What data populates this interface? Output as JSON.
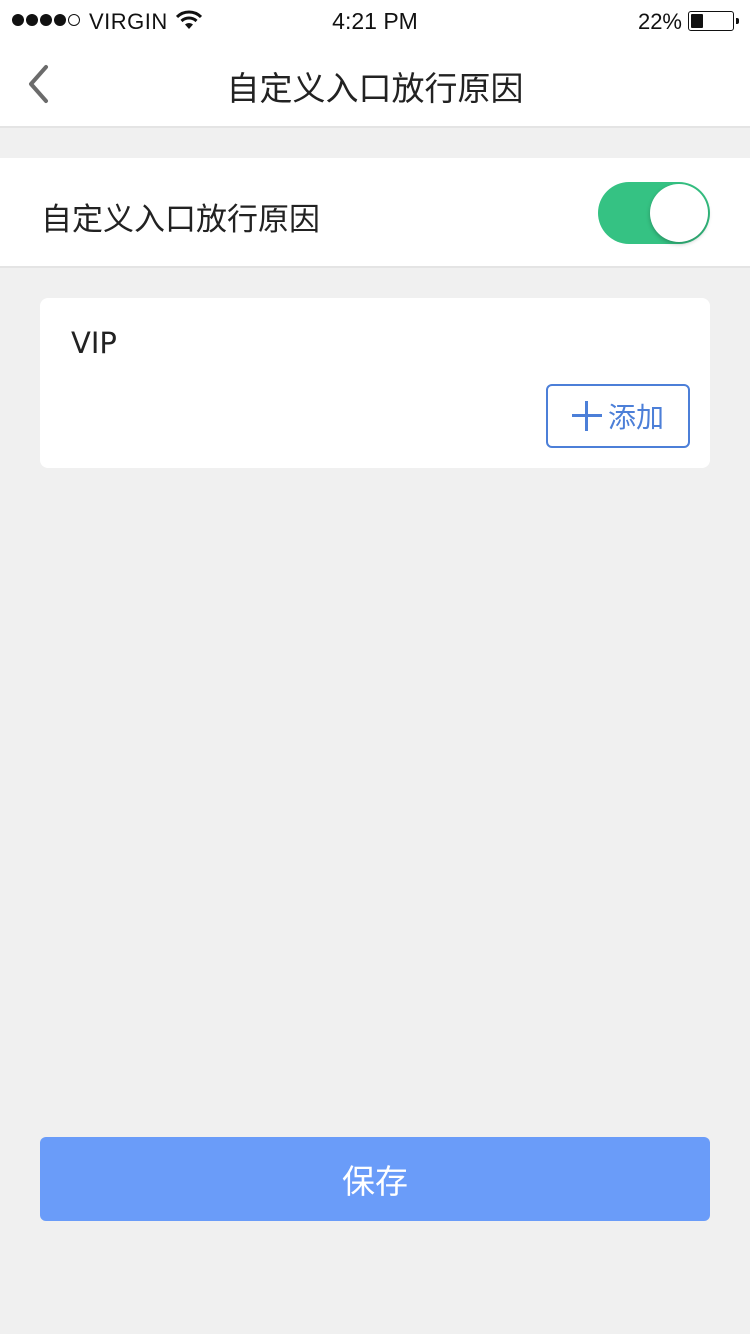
{
  "status_bar": {
    "carrier": "VIRGIN",
    "time": "4:21 PM",
    "battery_percent": "22%",
    "battery_level": 0.22,
    "signal_bars": 4,
    "signal_total": 5
  },
  "nav": {
    "title": "自定义入口放行原因",
    "back_icon": "chevron-left-icon"
  },
  "toggle_row": {
    "label": "自定义入口放行原因",
    "enabled": true,
    "on_color": "#35c283"
  },
  "reasons_card": {
    "items": [
      "VIP"
    ],
    "add_label": "添加",
    "add_icon": "plus-icon",
    "accent": "#4c7fd8"
  },
  "footer": {
    "save_label": "保存",
    "save_color": "#6a9cf9"
  }
}
